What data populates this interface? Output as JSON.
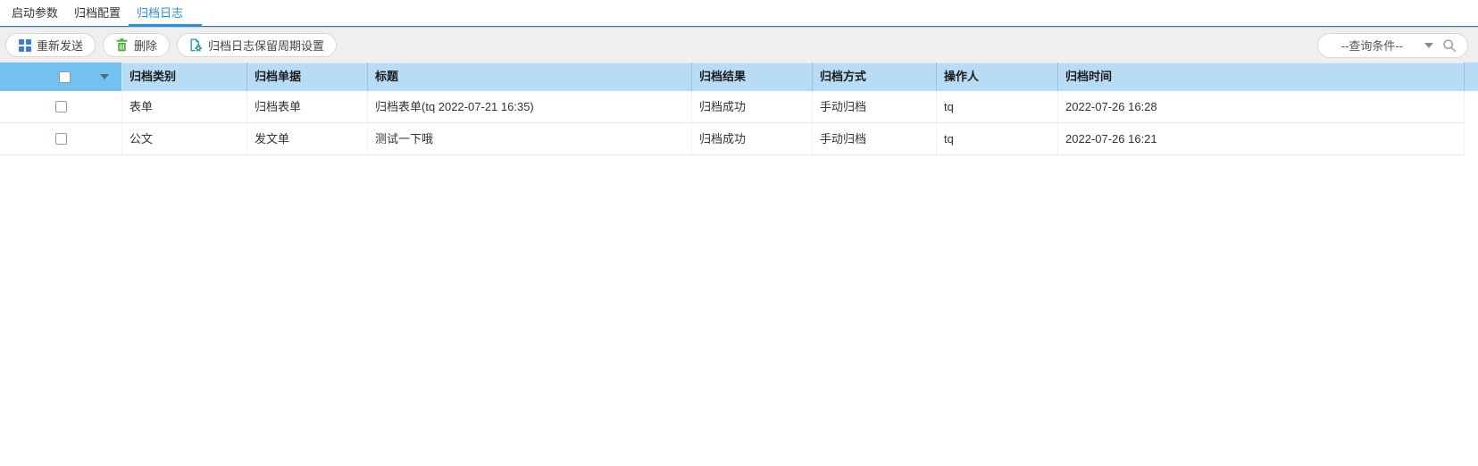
{
  "tabs": [
    {
      "label": "启动参数",
      "active": false
    },
    {
      "label": "归档配置",
      "active": false
    },
    {
      "label": "归档日志",
      "active": true
    }
  ],
  "toolbar": {
    "buttons": [
      {
        "label": "重新发送",
        "icon": "resend-icon"
      },
      {
        "label": "删除",
        "icon": "trash-icon"
      },
      {
        "label": "归档日志保留周期设置",
        "icon": "doc-gear-icon"
      }
    ],
    "query": {
      "label": "--查询条件--",
      "dropdown_icon": "chevron-down-icon",
      "search_icon": "search-icon"
    }
  },
  "table": {
    "columns": [
      "归档类别",
      "归档单据",
      "标题",
      "归档结果",
      "归档方式",
      "操作人",
      "归档时间"
    ],
    "rows": [
      {
        "category": "表单",
        "document": "归档表单",
        "title": "归档表单(tq 2022-07-21 16:35)",
        "result": "归档成功",
        "method": "手动归档",
        "operator": "tq",
        "time": "2022-07-26 16:28"
      },
      {
        "category": "公文",
        "document": "发文单",
        "title": "测试一下哦",
        "result": "归档成功",
        "method": "手动归档",
        "operator": "tq",
        "time": "2022-07-26 16:21"
      }
    ]
  },
  "colors": {
    "accent_blue": "#2b8ce0",
    "header_bg": "#b9dcf6",
    "header_first_col_bg": "#72c1ee",
    "toolbar_bg": "#efefef",
    "resend_icon_blue": "#3b7dd8",
    "trash_icon_green": "#52b43c",
    "doc_gear_icon_teal": "#2da3a3",
    "row_border": "#eaeaea"
  }
}
